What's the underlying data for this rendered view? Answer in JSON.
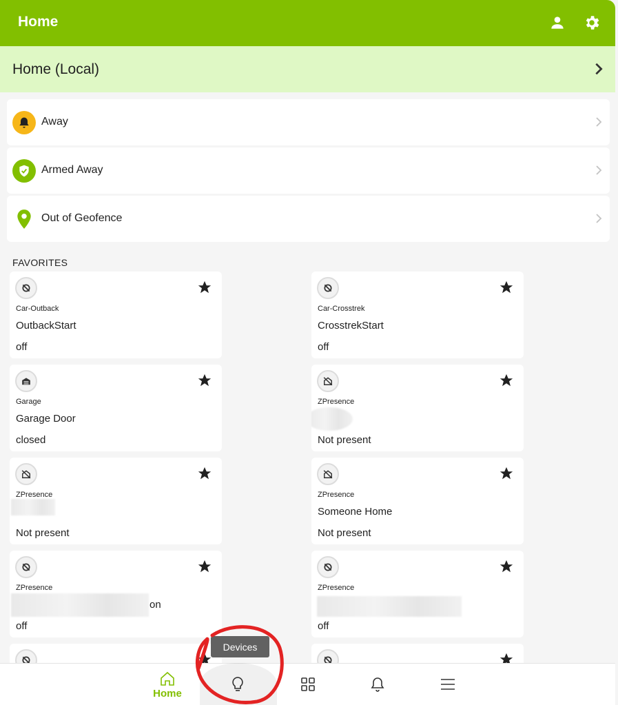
{
  "appbar": {
    "title": "Home",
    "user_icon": "account-icon",
    "settings_icon": "gear-icon",
    "color": "#82bf00"
  },
  "location": {
    "title": "Home (Local)",
    "background": "#dff8c5"
  },
  "status": [
    {
      "label": "Away",
      "icon": "bell-icon",
      "color": "#f6b619"
    },
    {
      "label": "Armed Away",
      "icon": "shield-check-icon",
      "color": "#82bf00"
    },
    {
      "label": "Out of Geofence",
      "icon": "map-pin-icon",
      "color": "#82bf00"
    }
  ],
  "favorites": {
    "title": "FAVORITES",
    "tiles": [
      {
        "room": "Car-Outback",
        "name": "OutbackStart",
        "state": "off",
        "icon": "power-off-icon"
      },
      {
        "room": "Car-Crosstrek",
        "name": "CrosstrekStart",
        "state": "off",
        "icon": "power-off-icon"
      },
      {
        "room": "Garage",
        "name": "Garage Door",
        "state": "closed",
        "icon": "garage-icon"
      },
      {
        "room": "ZPresence",
        "name": "",
        "state": "Not present",
        "icon": "home-off-icon"
      },
      {
        "room": "ZPresence",
        "name": "",
        "state": "Not present",
        "icon": "home-off-icon"
      },
      {
        "room": "ZPresence",
        "name": "Someone Home",
        "state": "Not present",
        "icon": "home-off-icon"
      },
      {
        "room": "ZPresence",
        "name": "on",
        "state": "off",
        "icon": "power-off-icon"
      },
      {
        "room": "ZPresence",
        "name": "",
        "state": "off",
        "icon": "power-off-icon"
      }
    ]
  },
  "tooltip": "Devices",
  "bottom_nav": [
    {
      "label": "Home",
      "icon": "home-icon",
      "active": true
    },
    {
      "label": "",
      "icon": "lightbulb-icon"
    },
    {
      "label": "",
      "icon": "dashboard-grid-icon"
    },
    {
      "label": "",
      "icon": "bell-icon"
    },
    {
      "label": "",
      "icon": "menu-icon"
    }
  ]
}
